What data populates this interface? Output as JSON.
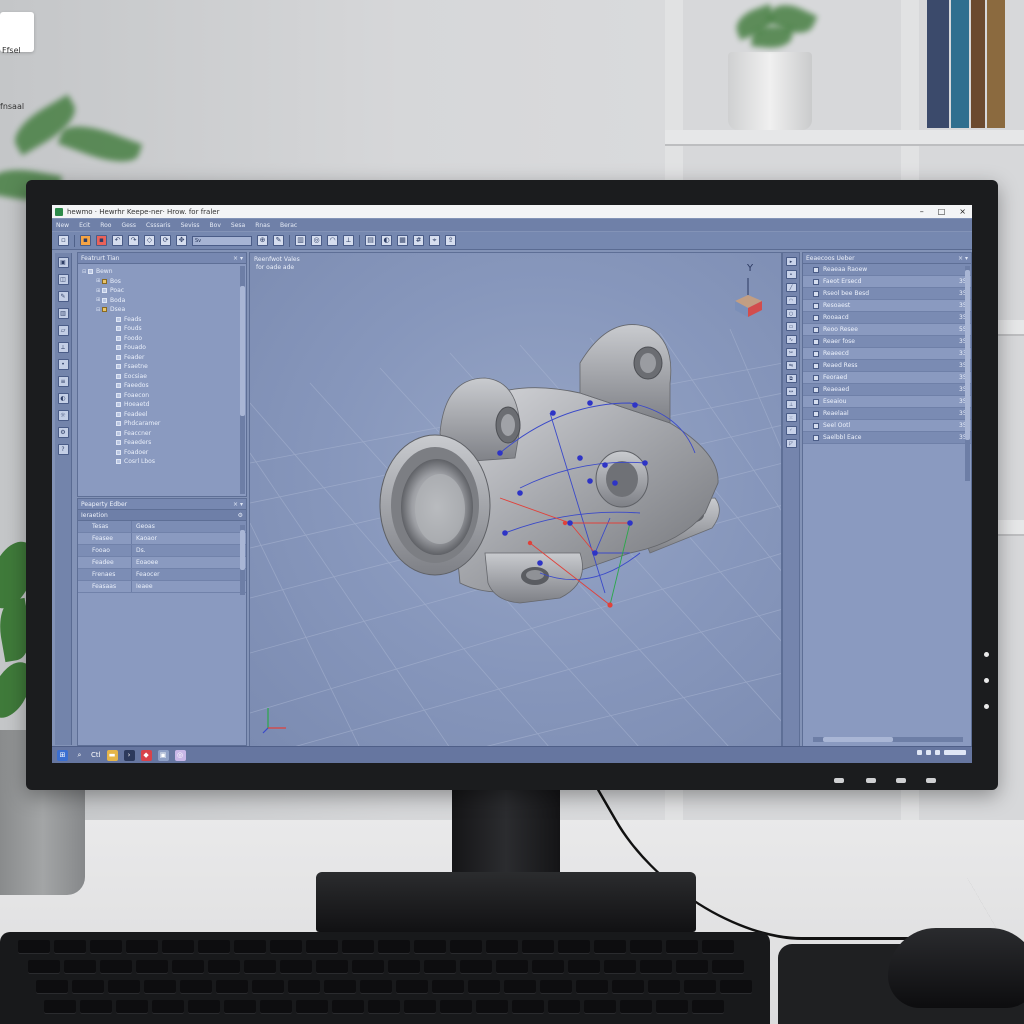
{
  "window": {
    "title": "hewmo · Hewrhr Keepe-ner· Hrow. for fraler",
    "controls": [
      "–",
      "□",
      "×"
    ]
  },
  "menu": [
    "New",
    "Ecit",
    "Roo",
    "Gess",
    "Csssaris",
    "Seviss",
    "Bov",
    "Sesa",
    "Rnas",
    "Berac"
  ],
  "toolbar": {
    "combo_value": "Sv",
    "icons": [
      "new-icon",
      "open-icon",
      "save-icon",
      "undo-icon",
      "redo-icon",
      "select-icon",
      "rotate-icon",
      "pan-icon",
      "zoom-icon",
      "sketch-icon",
      "extrude-icon",
      "revolve-icon",
      "fillet-icon",
      "measure-icon",
      "section-icon",
      "render-icon",
      "view-icon",
      "grid-icon",
      "snap-icon",
      "export-icon"
    ]
  },
  "feature_tree": {
    "title": "Featrurt Tian",
    "items": [
      {
        "label": "Bewn",
        "level": 0,
        "type": "part"
      },
      {
        "label": "Bos",
        "level": 1,
        "type": "folder"
      },
      {
        "label": "Poac",
        "level": 1,
        "type": "part"
      },
      {
        "label": "Boda",
        "level": 1,
        "type": "part"
      },
      {
        "label": "Dsea",
        "level": 2,
        "type": "folder"
      },
      {
        "label": "Feads",
        "level": 3,
        "type": "part"
      },
      {
        "label": "Fouds",
        "level": 3,
        "type": "part"
      },
      {
        "label": "Foodo",
        "level": 3,
        "type": "part"
      },
      {
        "label": "Fouado",
        "level": 3,
        "type": "part"
      },
      {
        "label": "Feader",
        "level": 3,
        "type": "part"
      },
      {
        "label": "Fsaetne",
        "level": 3,
        "type": "part"
      },
      {
        "label": "Eocsiae",
        "level": 3,
        "type": "part"
      },
      {
        "label": "Faeedos",
        "level": 3,
        "type": "part"
      },
      {
        "label": "Foaecon",
        "level": 3,
        "type": "part"
      },
      {
        "label": "Hoeaetd",
        "level": 3,
        "type": "part"
      },
      {
        "label": "Feadeel",
        "level": 3,
        "type": "part"
      },
      {
        "label": "Phdcaramer",
        "level": 3,
        "type": "part"
      },
      {
        "label": "Feaccner",
        "level": 3,
        "type": "part"
      },
      {
        "label": "Feaeders",
        "level": 3,
        "type": "part"
      },
      {
        "label": "Foadoer",
        "level": 3,
        "type": "part"
      },
      {
        "label": "Cosrl Lbos",
        "level": 3,
        "type": "part"
      }
    ]
  },
  "property_editor": {
    "title": "Peaperty Edber",
    "header": "Ieraetion",
    "rows": [
      {
        "key": "Tesas",
        "value": "Geoas"
      },
      {
        "key": "Feasee",
        "value": "Kaoaor"
      },
      {
        "key": "Fooao",
        "value": "Ds."
      },
      {
        "key": "Feadee",
        "value": "Eoaoee"
      },
      {
        "key": "Frenaes",
        "value": "Feaocer"
      },
      {
        "key": "Feasaas",
        "value": "Ieaee"
      }
    ]
  },
  "viewport": {
    "title": "Reenfwot Vales",
    "subtitle": "for oade ade",
    "axes": {
      "y": "Y"
    }
  },
  "right_panel": {
    "title": "Eeaecoos Ueber",
    "items": [
      {
        "label": "Reaeaa Raoew",
        "num": ""
      },
      {
        "label": "Faeot Ersecd",
        "num": "35"
      },
      {
        "label": "Rseol bee Besd",
        "num": "35"
      },
      {
        "label": "Resoaest",
        "num": "35"
      },
      {
        "label": "Rooaacd",
        "num": "35"
      },
      {
        "label": "Reoo Resee",
        "num": "55"
      },
      {
        "label": "Reaer fose",
        "num": "35"
      },
      {
        "label": "Reaeecd",
        "num": "33"
      },
      {
        "label": "Reaed Ress",
        "num": "35"
      },
      {
        "label": "Feoraed",
        "num": "35"
      },
      {
        "label": "Reaeaed",
        "num": "35"
      },
      {
        "label": "Eseaiou",
        "num": "35"
      },
      {
        "label": "Reaelaal",
        "num": "35"
      },
      {
        "label": "Seel Ootl",
        "num": "35"
      },
      {
        "label": "Saelbbl Eace",
        "num": "35"
      }
    ]
  },
  "taskbar": {
    "search_text": "Ctl",
    "tray_time": "",
    "icons": [
      "windows-icon",
      "search-icon",
      "task-view-icon",
      "explorer-icon",
      "terminal-icon",
      "cad-app-icon",
      "edge-icon",
      "store-icon"
    ]
  },
  "desktop": {
    "file_label": "Ffsel",
    "side_label": "fnsaal"
  },
  "colors": {
    "ui_bg": "#8393b7",
    "panel": "#8a9ac0",
    "accent": "#f5a445",
    "part": "#b3b5ba",
    "sketch_line": "#3a49c9",
    "constraint": "#e0413a"
  }
}
